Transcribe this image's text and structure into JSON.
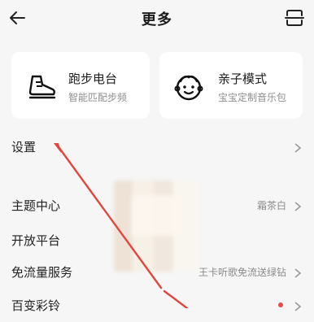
{
  "header": {
    "title": "更多"
  },
  "cards": [
    {
      "title": "跑步电台",
      "subtitle": "智能匹配步频",
      "icon": "running-shoe-icon"
    },
    {
      "title": "亲子模式",
      "subtitle": "宝宝定制音乐包",
      "icon": "baby-face-icon"
    }
  ],
  "rows": {
    "settings": {
      "label": "设置"
    },
    "theme": {
      "label": "主题中心",
      "value": "霜茶白"
    },
    "open_platform": {
      "label": "开放平台"
    },
    "free_data": {
      "label": "免流量服务",
      "value": "王卡听歌免流送绿钻"
    },
    "ringtone": {
      "label": "百变彩铃"
    }
  },
  "colors": {
    "background": "#f6f6f6",
    "card": "#ffffff",
    "annotation_arrow": "#e0473e",
    "badge": "#e84a4a"
  }
}
